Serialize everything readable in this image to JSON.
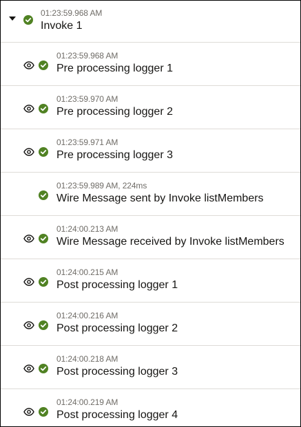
{
  "parent": {
    "timestamp": "01:23:59.968 AM",
    "title": "Invoke 1"
  },
  "icons": {
    "expand": "caret-down-icon",
    "view": "eye-icon",
    "status": "check-circle-icon"
  },
  "colors": {
    "success": "#508223",
    "border": "#dedbd7",
    "timestamp_text": "#6f6c67",
    "title_text": "#161513"
  },
  "rows": [
    {
      "timestamp": "01:23:59.968 AM",
      "title": "Pre processing logger 1",
      "has_view": true
    },
    {
      "timestamp": "01:23:59.970 AM",
      "title": "Pre processing logger 2",
      "has_view": true
    },
    {
      "timestamp": "01:23:59.971 AM",
      "title": "Pre processing logger 3",
      "has_view": true
    },
    {
      "timestamp": "01:23:59.989 AM, 224ms",
      "title": "Wire Message sent by Invoke listMembers",
      "has_view": false
    },
    {
      "timestamp": "01:24:00.213 AM",
      "title": "Wire Message received by Invoke listMembers",
      "has_view": true
    },
    {
      "timestamp": "01:24:00.215 AM",
      "title": "Post processing logger 1",
      "has_view": true
    },
    {
      "timestamp": "01:24:00.216 AM",
      "title": "Post processing logger 2",
      "has_view": true
    },
    {
      "timestamp": "01:24:00.218 AM",
      "title": "Post processing logger 3",
      "has_view": true
    },
    {
      "timestamp": "01:24:00.219 AM",
      "title": "Post processing logger 4",
      "has_view": true
    }
  ]
}
